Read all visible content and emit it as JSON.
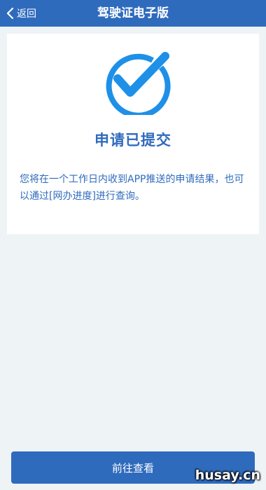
{
  "header": {
    "back_label": "返回",
    "title": "驾驶证电子版",
    "back_icon": "chevron-left-icon",
    "background": "#2f6bbd"
  },
  "result": {
    "icon": "check-circle-icon",
    "icon_color": "#1e90e8",
    "title": "申请已提交",
    "description": "您将在一个工作日内收到APP推送的申请结果，也可以通过[网办进度]进行查询。",
    "text_color": "#2f6bbd"
  },
  "footer": {
    "button_label": "前往查看"
  },
  "watermark": "husay.cn"
}
